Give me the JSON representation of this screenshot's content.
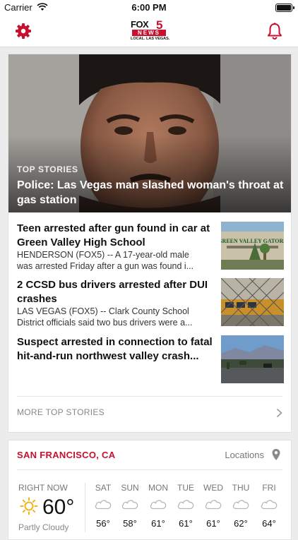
{
  "status_bar": {
    "carrier": "Carrier",
    "time": "6:00 PM"
  },
  "header": {
    "logo": {
      "fox": "FOX",
      "five": "5",
      "news": "NEWS",
      "tagline": "LOCAL. LAS VEGAS."
    },
    "left_icon": "gear-icon",
    "right_icon": "bell-icon",
    "accent_color": "#c8102e"
  },
  "top_stories": {
    "featured": {
      "kicker": "TOP STORIES",
      "headline": "Police: Las Vegas man slashed woman's throat at gas station"
    },
    "stories": [
      {
        "title": "Teen arrested after gun found in car at Green Valley High School",
        "summary_line1": "HENDERSON (FOX5) -- A 17-year-old male",
        "summary_line2": "was arrested Friday after a gun was found i...",
        "thumb_text": "GREEN VALLEY GATORS"
      },
      {
        "title": "2 CCSD bus drivers arrested after DUI crashes",
        "summary_line1": "LAS VEGAS (FOX5) -- Clark County School",
        "summary_line2": "District officials said two bus drivers were a..."
      },
      {
        "title": "Suspect arrested in connection to fatal hit-and-run northwest valley crash...",
        "summary_line1": "",
        "summary_line2": ""
      }
    ],
    "more_label": "MORE TOP STORIES"
  },
  "weather": {
    "city": "SAN FRANCISCO, CA",
    "locations_label": "Locations",
    "right_now_label": "RIGHT NOW",
    "current_temp": "60°",
    "current_condition": "Partly Cloudy",
    "forecast": [
      {
        "day": "SAT",
        "temp": "56°",
        "icon": "cloud-icon"
      },
      {
        "day": "SUN",
        "temp": "58°",
        "icon": "cloud-icon"
      },
      {
        "day": "MON",
        "temp": "61°",
        "icon": "cloud-icon"
      },
      {
        "day": "TUE",
        "temp": "61°",
        "icon": "cloud-icon"
      },
      {
        "day": "WED",
        "temp": "61°",
        "icon": "cloud-icon"
      },
      {
        "day": "THU",
        "temp": "62°",
        "icon": "cloud-icon"
      },
      {
        "day": "FRI",
        "temp": "64°",
        "icon": "cloud-icon"
      }
    ]
  }
}
